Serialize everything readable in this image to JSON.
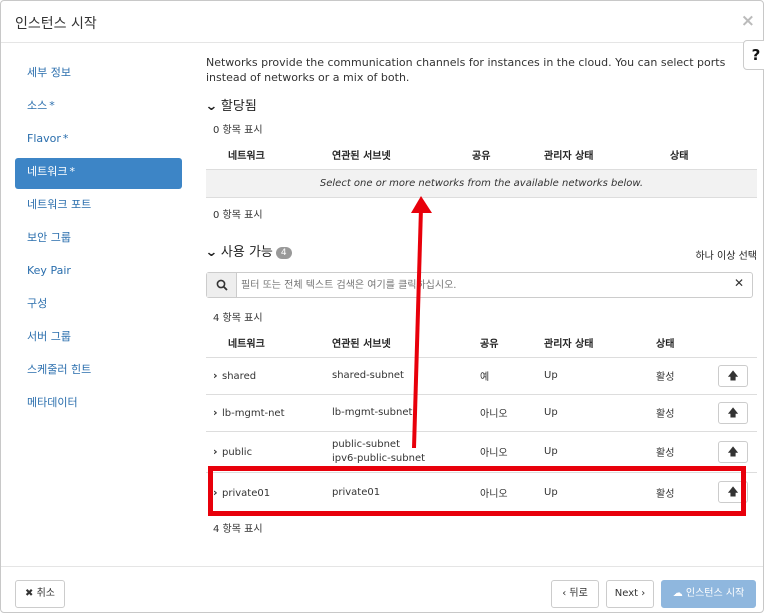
{
  "modal": {
    "title": "인스턴스 시작",
    "close": "×",
    "help": "?"
  },
  "sidebar": {
    "items": [
      {
        "label": "세부 정보",
        "required": ""
      },
      {
        "label": "소스",
        "required": "*"
      },
      {
        "label": "Flavor",
        "required": "*"
      },
      {
        "label": "네트워크",
        "required": "*"
      },
      {
        "label": "네트워크 포트",
        "required": ""
      },
      {
        "label": "보안 그룹",
        "required": ""
      },
      {
        "label": "Key Pair",
        "required": ""
      },
      {
        "label": "구성",
        "required": ""
      },
      {
        "label": "서버 그룹",
        "required": ""
      },
      {
        "label": "스케줄러 힌트",
        "required": ""
      },
      {
        "label": "메타데이터",
        "required": ""
      }
    ]
  },
  "content": {
    "description": "Networks provide the communication channels for instances in the cloud. You can select ports instead of networks or a mix of both.",
    "allocated": {
      "title": "할당됨",
      "count_top": "0 항목 표시",
      "count_bottom": "0 항목 표시",
      "columns": [
        "네트워크",
        "연관된 서브넷",
        "공유",
        "관리자 상태",
        "상태"
      ],
      "empty_message": "Select one or more networks from the available networks below."
    },
    "available": {
      "title": "사용 가능",
      "badge": "4",
      "select_hint": "하나 이상 선택",
      "search_placeholder": "필터 또는 전체 텍스트 검색은 여기를 클릭하십시오.",
      "count_top": "4 항목 표시",
      "count_bottom": "4 항목 표시",
      "columns": [
        "네트워크",
        "연관된 서브넷",
        "공유",
        "관리자 상태",
        "상태"
      ],
      "rows": [
        {
          "name": "shared",
          "subnet": "shared-subnet",
          "subnet2": "",
          "shared": "예",
          "admin_state": "Up",
          "status": "활성"
        },
        {
          "name": "lb-mgmt-net",
          "subnet": "lb-mgmt-subnet",
          "subnet2": "",
          "shared": "아니오",
          "admin_state": "Up",
          "status": "활성"
        },
        {
          "name": "public",
          "subnet": "public-subnet",
          "subnet2": "ipv6-public-subnet",
          "shared": "아니오",
          "admin_state": "Up",
          "status": "활성"
        },
        {
          "name": "private01",
          "subnet": "private01",
          "subnet2": "",
          "shared": "아니오",
          "admin_state": "Up",
          "status": "활성"
        }
      ]
    }
  },
  "footer": {
    "cancel": "취소",
    "back": "뒤로",
    "next": "Next",
    "launch": "인스턴스 시작"
  },
  "colors": {
    "accent": "#3d85c6",
    "annotation": "#e8000b"
  }
}
